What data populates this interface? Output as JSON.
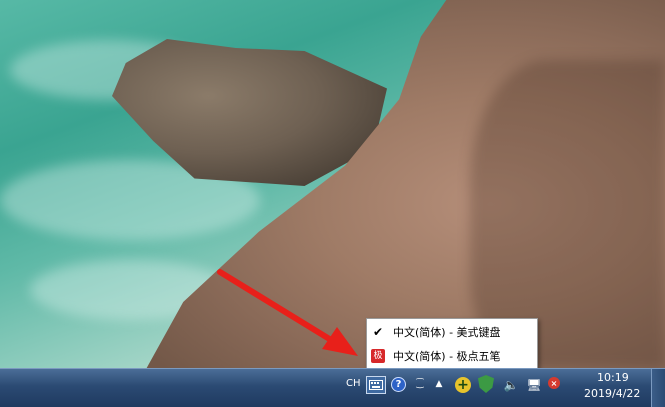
{
  "ime_menu": {
    "items": [
      {
        "label": "中文(简体) - 美式键盘",
        "selected": true,
        "icon": "check-icon"
      },
      {
        "label": "中文(简体) - 极点五笔",
        "selected": false,
        "icon": "ime-icon",
        "icon_text": "极"
      }
    ]
  },
  "taskbar": {
    "language": "CH",
    "ime_options_glyph": "⁐",
    "show_hidden_glyph": "▲",
    "help_glyph": "?",
    "add_glyph": "+",
    "network_error_glyph": "×",
    "volume_glyph": "🔈",
    "network_glyph": "🖥",
    "clock": {
      "time": "10:19",
      "date": "2019/4/22"
    }
  },
  "colors": {
    "taskbar": "#2b4a73",
    "arrow": "#e8201a",
    "ime_red": "#d7282a"
  }
}
